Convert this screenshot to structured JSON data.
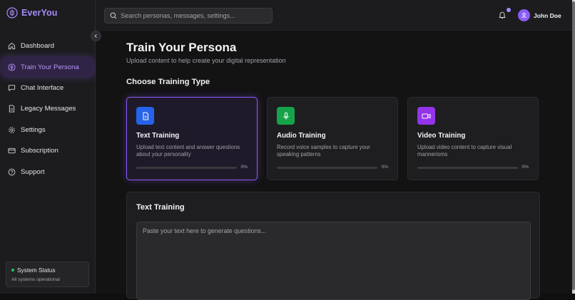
{
  "brand": {
    "name": "EverYou"
  },
  "search": {
    "placeholder": "Search personas, messages, settings..."
  },
  "user": {
    "name": "John Doe"
  },
  "sidebar": {
    "items": [
      {
        "label": "Dashboard",
        "icon": "home-icon"
      },
      {
        "label": "Train Your Persona",
        "icon": "brain-icon",
        "active": true
      },
      {
        "label": "Chat Interface",
        "icon": "chat-icon"
      },
      {
        "label": "Legacy Messages",
        "icon": "document-icon"
      },
      {
        "label": "Settings",
        "icon": "gear-icon"
      },
      {
        "label": "Subscription",
        "icon": "credit-card-icon"
      },
      {
        "label": "Support",
        "icon": "help-circle-icon"
      }
    ],
    "status": {
      "title": "System Status",
      "subtitle": "All systems operational"
    }
  },
  "main": {
    "title": "Train Your Persona",
    "subtitle": "Upload content to help create your digital representation",
    "section_title": "Choose Training Type",
    "cards": [
      {
        "title": "Text Training",
        "description": "Upload text content and answer questions about your personality",
        "progress_label": "0%",
        "progress": 0,
        "icon": "document-icon",
        "icon_color": "#2563eb"
      },
      {
        "title": "Audio Training",
        "description": "Record voice samples to capture your speaking patterns",
        "progress_label": "0%",
        "progress": 0,
        "icon": "microphone-icon",
        "icon_color": "#16a34a"
      },
      {
        "title": "Video Training",
        "description": "Upload video content to capture visual mannerisms",
        "progress_label": "0%",
        "progress": 0,
        "icon": "video-icon",
        "icon_color": "#9333ea"
      }
    ],
    "panel": {
      "title": "Text Training",
      "placeholder": "Paste your text here to generate questions..."
    }
  },
  "colors": {
    "accent": "#8b5cf6",
    "status_ok": "#22c55e"
  }
}
